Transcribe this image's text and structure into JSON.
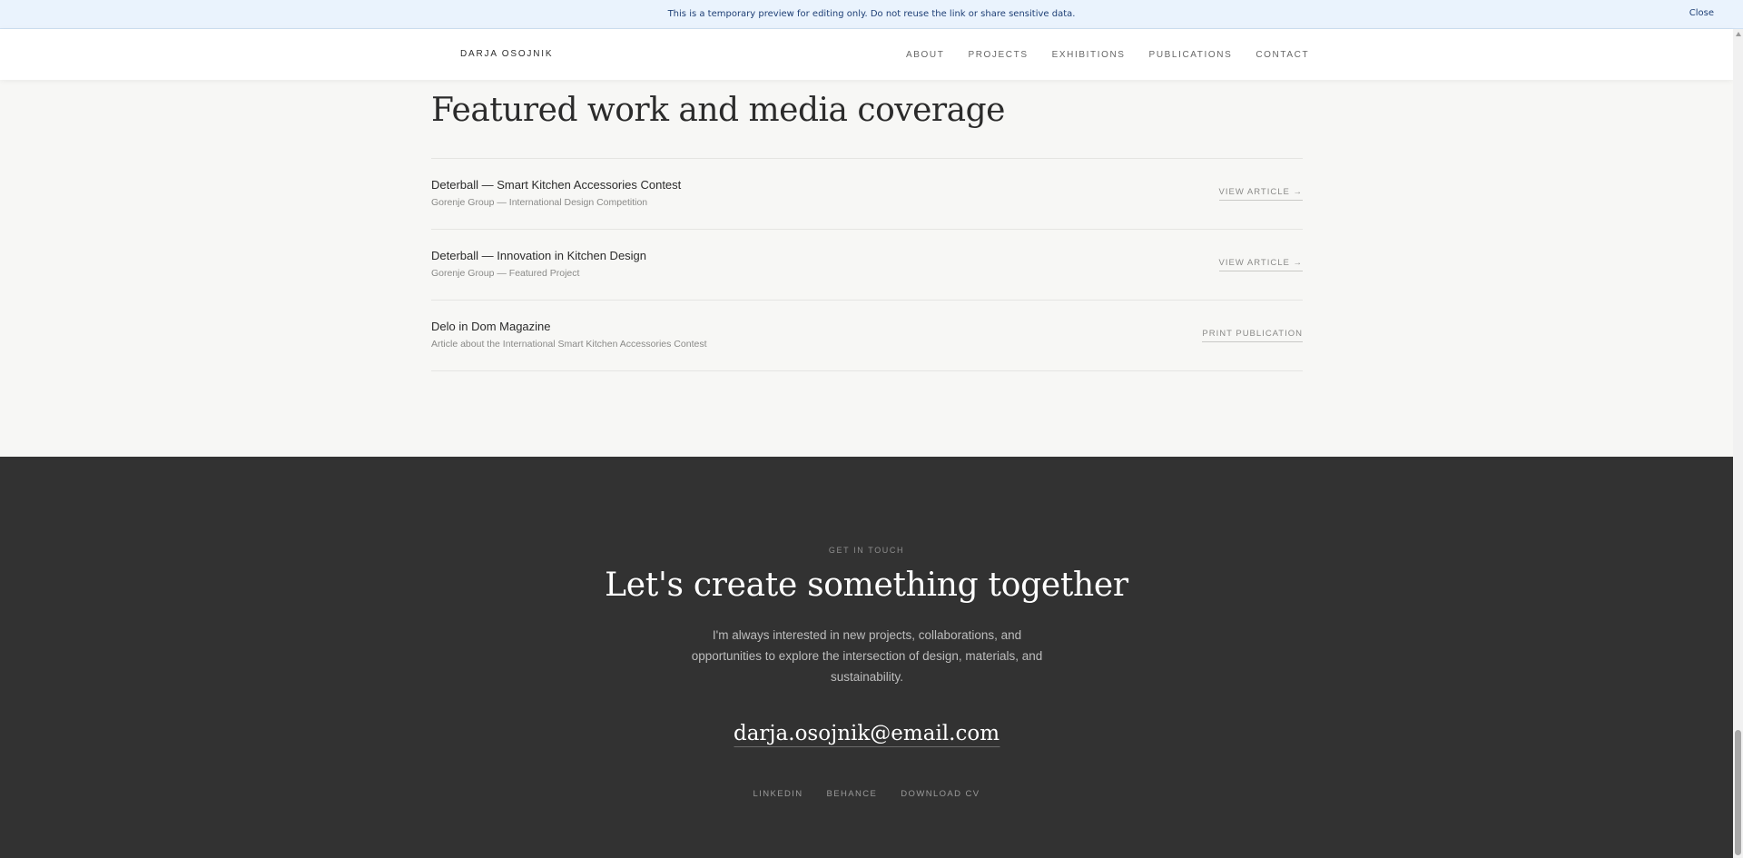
{
  "banner": {
    "message": "This is a temporary preview for editing only. Do not reuse the link or share sensitive data.",
    "close_label": "Close"
  },
  "header": {
    "brand": "DARJA OSOJNIK",
    "nav": [
      "ABOUT",
      "PROJECTS",
      "EXHIBITIONS",
      "PUBLICATIONS",
      "CONTACT"
    ]
  },
  "featured": {
    "heading": "Featured work and media coverage",
    "items": [
      {
        "title": "Deterball — Smart Kitchen Accessories Contest",
        "subtitle": "Gorenje Group — International Design Competition",
        "action": "VIEW ARTICLE →"
      },
      {
        "title": "Deterball — Innovation in Kitchen Design",
        "subtitle": "Gorenje Group — Featured Project",
        "action": "VIEW ARTICLE →"
      },
      {
        "title": "Delo in Dom Magazine",
        "subtitle": "Article about the International Smart Kitchen Accessories Contest",
        "action": "PRINT PUBLICATION"
      }
    ]
  },
  "contact": {
    "eyebrow": "GET IN TOUCH",
    "heading": "Let's create something together",
    "lead": "I'm always interested in new projects, collaborations, and opportunities to explore the intersection of design, materials, and sustainability.",
    "email": "darja.osojnik@email.com",
    "links": [
      "LINKEDIN",
      "BEHANCE",
      "DOWNLOAD CV"
    ]
  },
  "colors": {
    "banner_bg": "#eaf3fd",
    "page_bg": "#f7f7f5",
    "footer_bg": "#323232",
    "text_dark": "#2b2b2b"
  }
}
